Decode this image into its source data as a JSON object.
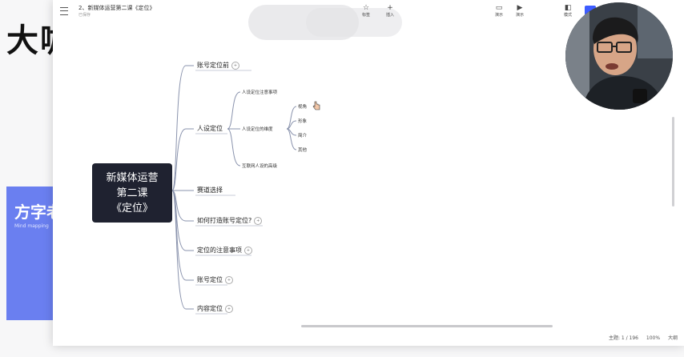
{
  "background": {
    "big_text": "大咖",
    "card_title": "方字老",
    "card_subtitle": "Mind mapping"
  },
  "window": {
    "title": "2、新媒体运营第二课《定位》",
    "subtitle": "已保存",
    "toolbar": [
      {
        "icon": "star-icon",
        "label": "标签"
      },
      {
        "icon": "plus-icon",
        "label": "插入"
      },
      {
        "icon": "present-icon",
        "label": "演示"
      },
      {
        "icon": "play-icon",
        "label": "演示"
      },
      {
        "icon": "theme-icon",
        "label": "模式"
      }
    ]
  },
  "mindmap": {
    "root": [
      "新媒体运营",
      "第二课",
      "《定位》"
    ],
    "branches": [
      {
        "label": "账号定位前"
      },
      {
        "label": "人设定位"
      },
      {
        "label": "赛道选择"
      },
      {
        "label": "如何打造账号定位?"
      },
      {
        "label": "定位的注意事项"
      },
      {
        "label": "账号定位"
      },
      {
        "label": "内容定位"
      }
    ],
    "persona_children": [
      "人设定位注意事项",
      "人设定位的维度",
      "互联网人设的高级"
    ],
    "dimension_children": [
      "视角",
      "形象",
      "简介",
      "其他"
    ]
  },
  "status": {
    "words": "主题: 1 / 196",
    "zoom": "100%",
    "fit": "大纲"
  },
  "colors": {
    "accent": "#3d5cff",
    "branch_line": "#8a93ad",
    "root_bg": "#1f2230",
    "card": "#6a7ff0"
  }
}
